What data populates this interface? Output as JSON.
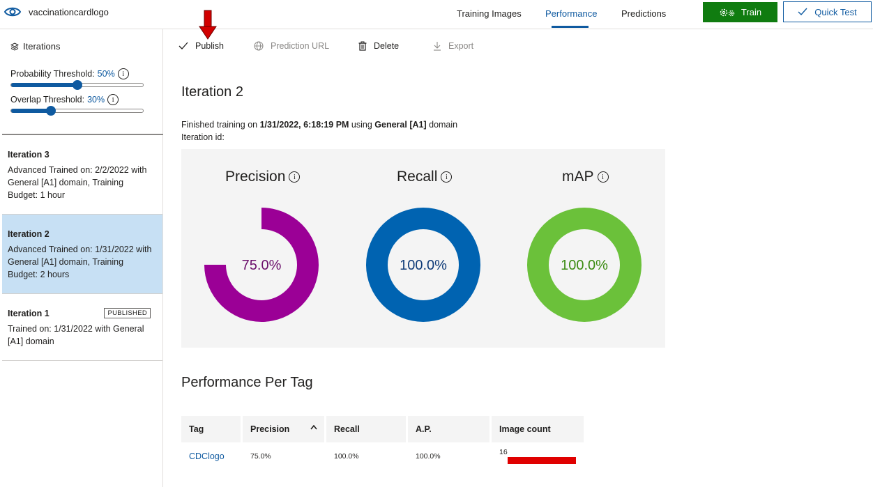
{
  "app": {
    "project_title": "vaccinationcardlogo"
  },
  "nav": {
    "tabs": [
      "Training Images",
      "Performance",
      "Predictions"
    ],
    "active_tab": "Performance"
  },
  "buttons": {
    "train_label": "Train",
    "quick_test_label": "Quick Test"
  },
  "left_panel": {
    "header": "Iterations",
    "probability": {
      "label": "Probability Threshold: ",
      "value": "50%",
      "level": 0.5
    },
    "overlap": {
      "label": "Overlap Threshold: ",
      "value": "30%",
      "level": 0.3
    },
    "iterations": [
      {
        "name": "Iteration 3",
        "desc": "Advanced Trained on: 2/2/2022 with General [A1] domain, Training Budget: 1 hour",
        "badge": ""
      },
      {
        "name": "Iteration 2",
        "desc": "Advanced Trained on: 1/31/2022 with General [A1] domain, Training Budget: 2 hours",
        "badge": ""
      },
      {
        "name": "Iteration 1",
        "desc": "Trained on: 1/31/2022 with General [A1] domain",
        "badge": "PUBLISHED"
      }
    ]
  },
  "commands": {
    "publish": "Publish",
    "prediction_url": "Prediction URL",
    "delete": "Delete",
    "export": "Export"
  },
  "main": {
    "iteration_title": "Iteration 2",
    "finished_prefix": "Finished training on ",
    "finished_date": "1/31/2022, 6:18:19 PM",
    "finished_mid": " using ",
    "finished_domain": "General [A1]",
    "finished_suffix": " domain",
    "iteration_id_label": "Iteration id:",
    "metrics": [
      {
        "name": "Precision",
        "value_text": "75.0%",
        "value": 75.0,
        "color": "#9b0096",
        "text_color": "#6b0f6b"
      },
      {
        "name": "Recall",
        "value_text": "100.0%",
        "value": 100.0,
        "color": "#0063b1",
        "text_color": "#0f3b78"
      },
      {
        "name": "mAP",
        "value_text": "100.0%",
        "value": 100.0,
        "color": "#6bc13a",
        "text_color": "#3a8a10"
      }
    ],
    "per_tag_title": "Performance Per Tag",
    "table": {
      "headers": [
        "Tag",
        "Precision",
        "Recall",
        "A.P.",
        "Image count"
      ],
      "rows": [
        {
          "tag": "CDClogo",
          "precision": "75.0%",
          "recall": "100.0%",
          "ap": "100.0%",
          "image_count": "16"
        }
      ]
    }
  },
  "colors": {
    "accent": "#0f5aa0",
    "train_green": "#107c10",
    "selected_bg": "#c7e0f4",
    "annotation_arrow": "#d10000"
  }
}
